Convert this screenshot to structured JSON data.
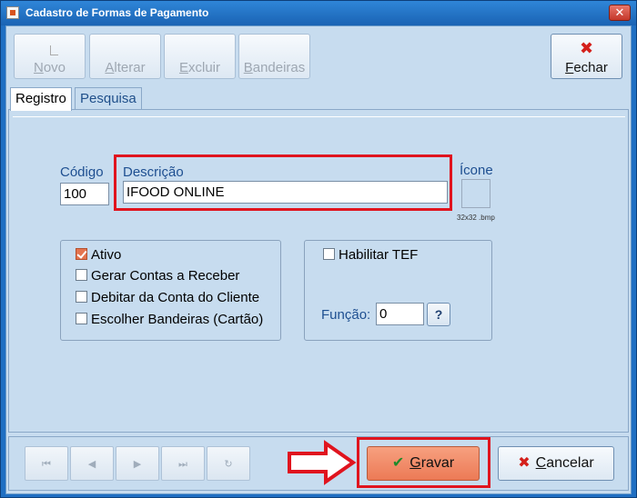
{
  "window": {
    "title": "Cadastro de Formas de Pagamento",
    "close_glyph": "✕"
  },
  "toolbar": {
    "novo": {
      "pre": "",
      "mnemonic": "N",
      "rest": "ovo"
    },
    "alterar": {
      "pre": "",
      "mnemonic": "A",
      "rest": "lterar"
    },
    "excluir": {
      "pre": "",
      "mnemonic": "E",
      "rest": "xcluir"
    },
    "bandeiras": {
      "pre": "",
      "mnemonic": "B",
      "rest": "andeiras"
    },
    "fechar": {
      "pre": "",
      "mnemonic": "F",
      "rest": "echar",
      "glyph": "✖"
    }
  },
  "tabs": [
    {
      "label": "Registro"
    },
    {
      "label": "Pesquisa"
    }
  ],
  "form": {
    "codigo_label": "Código",
    "codigo_value": "100",
    "descricao_label": "Descrição",
    "descricao_value": "IFOOD ONLINE",
    "icone_label": "Ícone",
    "icone_note": "32x32 .bmp"
  },
  "options": [
    {
      "label": "Ativo",
      "checked": true
    },
    {
      "label": "Gerar Contas a Receber",
      "checked": false
    },
    {
      "label": "Debitar da Conta do Cliente",
      "checked": false
    },
    {
      "label": "Escolher Bandeiras (Cartão)",
      "checked": false
    }
  ],
  "tef": {
    "label": "Habilitar TEF",
    "checked": false,
    "funcao_label": "Função:",
    "funcao_value": "0",
    "help_label": "?"
  },
  "nav": {
    "first": "⏮",
    "prev": "◀",
    "next": "▶",
    "last": "⏭",
    "refresh": "↻"
  },
  "actions": {
    "gravar": {
      "check_glyph": "✔",
      "mnemonic": "G",
      "rest": "ravar"
    },
    "cancelar": {
      "x_glyph": "✖",
      "mnemonic": "C",
      "rest": "ancelar"
    }
  },
  "colors": {
    "highlight": "#e0141e",
    "accent": "#ec7a56",
    "title_bar": "#1a63b4"
  }
}
